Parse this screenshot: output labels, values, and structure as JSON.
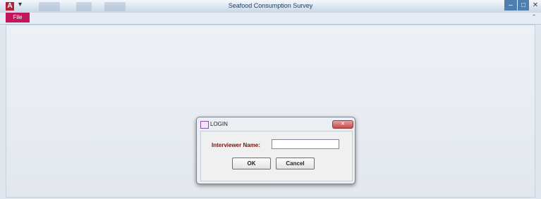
{
  "window": {
    "title": "Seafood Consumption Survey",
    "app_icon_letter": "A",
    "qat_arrow": "▾",
    "min": "–",
    "max": "□",
    "close": "✕"
  },
  "ribbon": {
    "file_tab": "File",
    "toggle": "⌃"
  },
  "dialog": {
    "title": "LOGIN",
    "close": "✕",
    "field_label": "Interviewer Name:",
    "field_value": "",
    "ok_label": "OK",
    "cancel_label": "Cancel"
  },
  "colors": {
    "accent": "#c2185b",
    "label": "#7a1010"
  }
}
